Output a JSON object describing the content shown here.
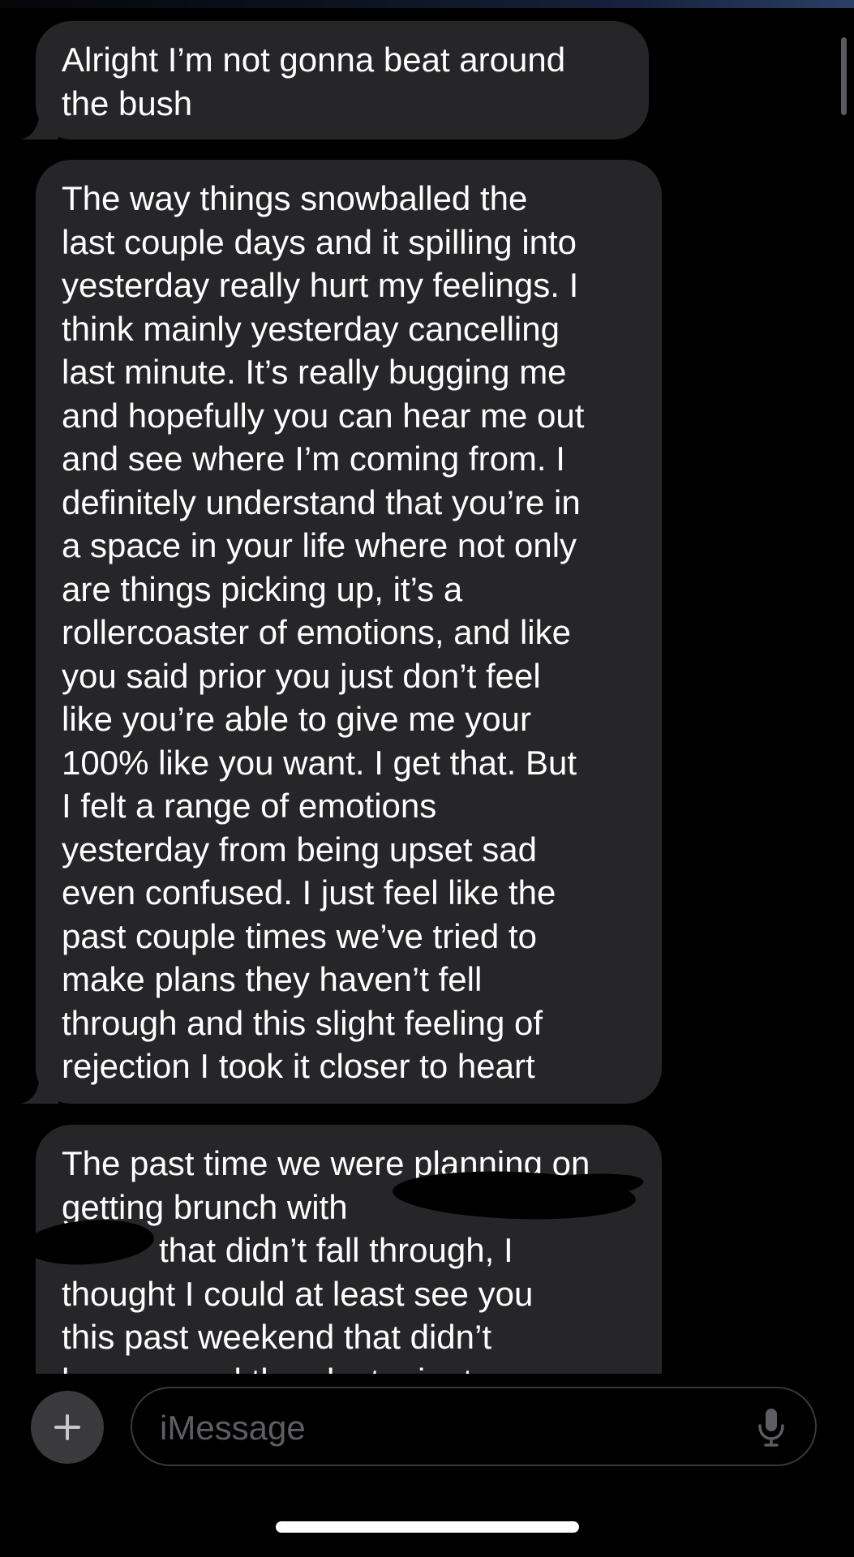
{
  "messages": [
    {
      "lines": [
        "Alright I’m not gonna beat around",
        "the bush"
      ]
    },
    {
      "lines": [
        "The way things snowballed the",
        "last couple days and it spilling into",
        "yesterday really hurt my feelings. I",
        "think mainly yesterday cancelling",
        "last minute. It’s really bugging me",
        "and hopefully you can hear me out",
        "and see where I’m coming from. I",
        "definitely understand that you’re in",
        "a space in your life where not only",
        "are things picking up, it’s a",
        "rollercoaster of emotions, and like",
        "you said prior you just don’t feel",
        "like you’re able to give me your",
        "100% like you want. I get that. But",
        "I felt a range of emotions",
        "yesterday from being upset sad",
        "even confused. I just feel like the",
        "past couple times we’ve tried to",
        "make plans they haven’t fell",
        "through and this slight feeling of",
        "rejection I took it closer to heart"
      ]
    },
    {
      "lines": [
        "The past time we were planning on",
        "getting brunch with",
        "that didn’t fall through, I",
        "thought I could at least see you",
        "this past weekend that didn’t",
        "happen and then last minute"
      ]
    }
  ],
  "composer": {
    "placeholder": "iMessage",
    "plus_label": "+",
    "plus_icon": "plus-icon",
    "mic_icon": "microphone-icon"
  },
  "colors": {
    "background": "#000000",
    "incoming_bubble": "#262628",
    "placeholder": "#5e5e62"
  }
}
